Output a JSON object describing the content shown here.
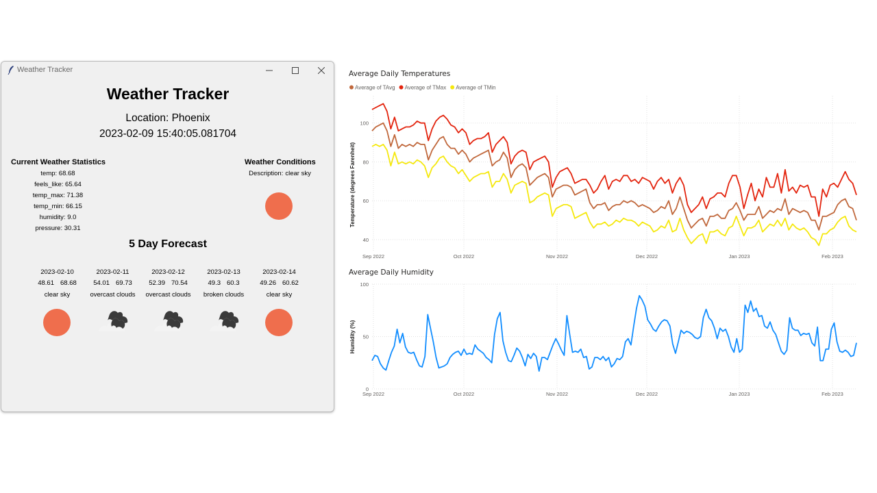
{
  "window": {
    "title": "Weather Tracker",
    "icons": {
      "app": "feather-icon",
      "minimize": "minimize-icon",
      "maximize": "maximize-icon",
      "close": "close-icon"
    }
  },
  "app": {
    "heading": "Weather Tracker",
    "location": "Location: Phoenix",
    "datetime": "2023-02-09 15:40:05.081704"
  },
  "current": {
    "title": "Current Weather Statistics",
    "stats": [
      {
        "label": "temp: 68.68"
      },
      {
        "label": "feels_like: 65.64"
      },
      {
        "label": "temp_max: 71.38"
      },
      {
        "label": "temp_min: 66.15"
      },
      {
        "label": "humidity: 9.0"
      },
      {
        "label": "pressure: 30.31"
      }
    ]
  },
  "conditions": {
    "title": "Weather Conditions",
    "desc_label": "Description:",
    "desc_value": "clear sky",
    "icon": "clear-sky-icon",
    "color": "#ef6e4d"
  },
  "forecast": {
    "title": "5 Day Forecast",
    "days": [
      {
        "date": "2023-02-10",
        "low": "48.61",
        "high": "68.68",
        "desc": "clear sky",
        "icon": "clear-sky-icon"
      },
      {
        "date": "2023-02-11",
        "low": "54.01",
        "high": "69.73",
        "desc": "overcast clouds",
        "icon": "overcast-clouds-icon"
      },
      {
        "date": "2023-02-12",
        "low": "52.39",
        "high": "70.54",
        "desc": "overcast clouds",
        "icon": "overcast-clouds-icon"
      },
      {
        "date": "2023-02-13",
        "low": "49.3",
        "high": "60.3",
        "desc": "broken clouds",
        "icon": "broken-clouds-icon"
      },
      {
        "date": "2023-02-14",
        "low": "49.26",
        "high": "60.62",
        "desc": "clear sky",
        "icon": "clear-sky-icon"
      }
    ]
  },
  "chart_data": [
    {
      "type": "line",
      "title": "Average Daily Temperatures",
      "xlabel": "",
      "ylabel": "Temperature (degrees Farenheit)",
      "ylim": [
        34,
        114
      ],
      "yticks": [
        40,
        60,
        80,
        100
      ],
      "xticks": [
        "Sep 2022",
        "Oct 2022",
        "Nov 2022",
        "Dec 2022",
        "Jan 2023",
        "Feb 2023"
      ],
      "grid": true,
      "legend": "top-left",
      "series": [
        {
          "name": "Average of TAvg",
          "color": "#c0673b",
          "values": [
            96,
            98,
            99,
            100,
            96,
            88,
            94,
            87,
            89,
            88,
            89,
            88,
            90,
            89,
            89,
            81,
            86,
            89,
            92,
            93,
            89,
            87,
            87,
            84,
            86,
            84,
            80,
            82,
            83,
            84,
            85,
            86,
            78,
            80,
            81,
            85,
            82,
            72,
            76,
            78,
            79,
            77,
            68,
            70,
            72,
            73,
            74,
            72,
            62,
            66,
            67,
            68,
            68,
            67,
            63,
            64,
            65,
            66,
            59,
            56,
            58,
            58,
            59,
            55,
            57,
            58,
            58,
            60,
            59,
            60,
            59,
            57,
            58,
            57,
            56,
            54,
            55,
            57,
            56,
            60,
            53,
            56,
            62,
            56,
            50,
            46,
            48,
            50,
            51,
            47,
            52,
            52,
            53,
            51,
            51,
            55,
            56,
            59,
            55,
            50,
            53,
            53,
            53,
            57,
            51,
            53,
            55,
            54,
            56,
            55,
            61,
            53,
            56,
            55,
            54,
            55,
            54,
            50,
            50,
            45,
            52,
            52,
            53,
            54,
            58,
            60,
            61,
            57,
            56,
            50
          ]
        },
        {
          "name": "Average of TMax",
          "color": "#e3230d",
          "values": [
            107,
            108,
            109,
            110,
            106,
            97,
            103,
            96,
            97,
            98,
            98,
            99,
            101,
            100,
            100,
            91,
            97,
            101,
            103,
            104,
            102,
            99,
            98,
            95,
            97,
            95,
            89,
            91,
            92,
            92,
            93,
            95,
            85,
            89,
            91,
            93,
            90,
            79,
            83,
            85,
            86,
            85,
            76,
            80,
            81,
            82,
            83,
            80,
            67,
            72,
            75,
            76,
            77,
            74,
            69,
            70,
            71,
            71,
            68,
            64,
            66,
            70,
            73,
            66,
            70,
            71,
            70,
            73,
            73,
            70,
            71,
            69,
            72,
            71,
            70,
            66,
            70,
            72,
            69,
            71,
            64,
            69,
            72,
            68,
            58,
            54,
            56,
            58,
            62,
            56,
            61,
            62,
            64,
            64,
            62,
            69,
            73,
            73,
            67,
            56,
            63,
            69,
            60,
            66,
            62,
            72,
            67,
            67,
            74,
            64,
            76,
            65,
            67,
            64,
            68,
            67,
            68,
            62,
            62,
            52,
            66,
            62,
            68,
            69,
            67,
            71,
            75,
            71,
            69,
            63
          ]
        },
        {
          "name": "Average of TMin",
          "color": "#f5e80d",
          "values": [
            88,
            89,
            88,
            89,
            86,
            78,
            85,
            79,
            80,
            79,
            80,
            79,
            81,
            80,
            78,
            72,
            77,
            79,
            82,
            83,
            80,
            78,
            77,
            74,
            76,
            73,
            70,
            72,
            73,
            74,
            74,
            75,
            67,
            70,
            70,
            74,
            71,
            64,
            68,
            69,
            70,
            69,
            59,
            60,
            62,
            63,
            64,
            63,
            52,
            56,
            57,
            58,
            58,
            57,
            51,
            52,
            53,
            54,
            49,
            46,
            48,
            48,
            49,
            47,
            48,
            50,
            49,
            51,
            50,
            50,
            49,
            47,
            49,
            48,
            47,
            44,
            45,
            47,
            46,
            50,
            44,
            45,
            51,
            45,
            41,
            38,
            40,
            42,
            43,
            38,
            44,
            44,
            45,
            43,
            42,
            46,
            47,
            52,
            47,
            42,
            46,
            46,
            47,
            50,
            44,
            46,
            48,
            47,
            50,
            47,
            51,
            45,
            48,
            46,
            45,
            46,
            44,
            41,
            40,
            37,
            43,
            43,
            45,
            46,
            49,
            51,
            52,
            47,
            45,
            44
          ]
        }
      ]
    },
    {
      "type": "line",
      "title": "Average Daily Humidity",
      "xlabel": "",
      "ylabel": "Humidity (%)",
      "ylim": [
        0,
        100
      ],
      "yticks": [
        0,
        50,
        100
      ],
      "xticks": [
        "Sep 2022",
        "Oct 2022",
        "Nov 2022",
        "Dec 2022",
        "Jan 2023",
        "Feb 2023"
      ],
      "grid": true,
      "series": [
        {
          "name": "Humidity (%)",
          "color": "#118dff",
          "values": [
            27,
            32,
            31,
            24,
            20,
            18,
            27,
            35,
            41,
            57,
            44,
            53,
            40,
            35,
            34,
            35,
            28,
            22,
            21,
            31,
            71,
            58,
            45,
            30,
            20,
            21,
            22,
            24,
            30,
            33,
            35,
            36,
            32,
            38,
            33,
            34,
            33,
            42,
            38,
            36,
            34,
            30,
            28,
            25,
            52,
            67,
            73,
            46,
            35,
            27,
            26,
            32,
            39,
            36,
            30,
            22,
            33,
            29,
            34,
            31,
            17,
            30,
            30,
            28,
            35,
            42,
            48,
            43,
            37,
            32,
            70,
            52,
            35,
            36,
            35,
            38,
            30,
            31,
            19,
            21,
            30,
            30,
            28,
            31,
            27,
            30,
            21,
            24,
            29,
            28,
            31,
            45,
            48,
            42,
            60,
            77,
            89,
            85,
            79,
            66,
            62,
            57,
            55,
            60,
            64,
            66,
            65,
            60,
            43,
            34,
            45,
            56,
            53,
            55,
            54,
            52,
            49,
            48,
            50,
            68,
            76,
            68,
            65,
            58,
            48,
            58,
            55,
            57,
            50,
            40,
            35,
            48,
            35,
            38,
            80,
            73,
            84,
            74,
            77,
            69,
            70,
            60,
            58,
            64,
            56,
            52,
            44,
            36,
            33,
            37,
            68,
            58,
            56,
            56,
            51,
            53,
            52,
            53,
            44,
            41,
            59,
            27,
            27,
            38,
            38,
            57,
            63,
            45,
            36,
            35,
            37,
            35,
            31,
            32,
            44
          ]
        }
      ]
    }
  ]
}
